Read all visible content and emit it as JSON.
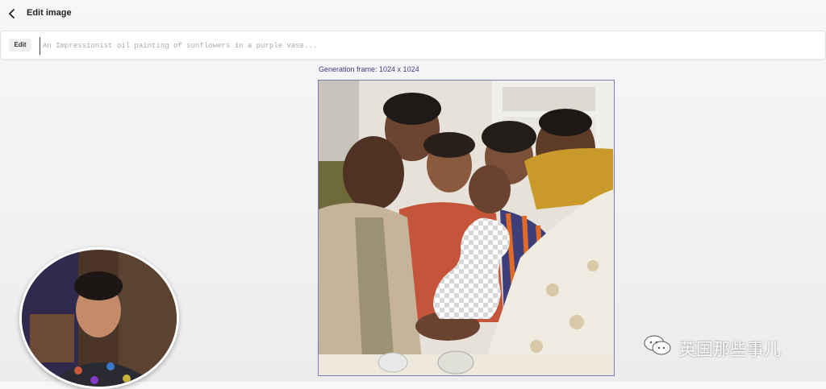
{
  "header": {
    "title": "Edit image",
    "back_icon": "back-arrow-icon"
  },
  "prompt_bar": {
    "edit_label": "Edit",
    "placeholder": "An Impressionist oil painting of sunflowers in a purple vase..."
  },
  "canvas": {
    "frame_label": "Generation frame: 1024 x 1024"
  },
  "overlay": {
    "watermark_text": "英国那些事儿",
    "watermark_icon": "wechat-icon"
  },
  "colors": {
    "frame_border": "#7d78b8",
    "frame_label": "#3e3a7a"
  }
}
